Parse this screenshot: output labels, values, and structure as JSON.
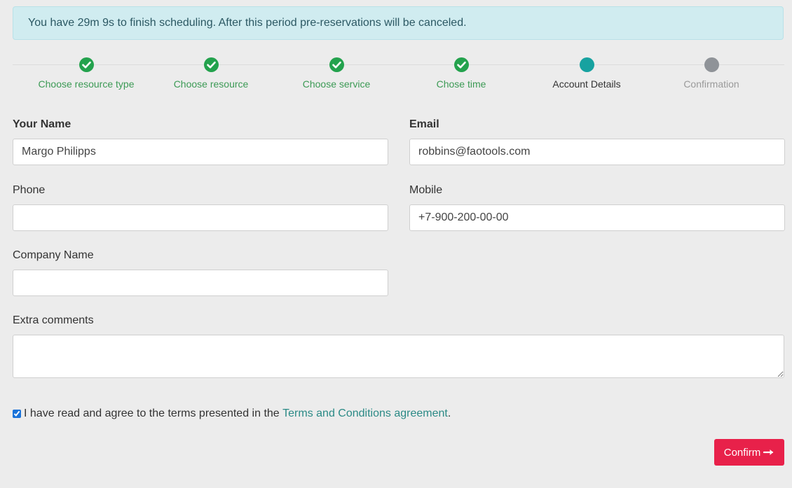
{
  "alert": {
    "message": "You have 29m 9s to finish scheduling. After this period pre-reservations will be canceled."
  },
  "steps": [
    {
      "label": "Choose resource type",
      "state": "done",
      "icon": "check-icon"
    },
    {
      "label": "Choose resource",
      "state": "done",
      "icon": "check-icon"
    },
    {
      "label": "Choose service",
      "state": "done",
      "icon": "check-icon"
    },
    {
      "label": "Chose time",
      "state": "done",
      "icon": "check-icon"
    },
    {
      "label": "Account Details",
      "state": "current",
      "icon": "dot-icon"
    },
    {
      "label": "Confirmation",
      "state": "pending",
      "icon": "dot-icon"
    }
  ],
  "form": {
    "name": {
      "label": "Your Name",
      "value": "Margo Philipps",
      "placeholder": ""
    },
    "email": {
      "label": "Email",
      "value": "robbins@faotools.com",
      "placeholder": ""
    },
    "phone": {
      "label": "Phone",
      "value": "",
      "placeholder": ""
    },
    "mobile": {
      "label": "Mobile",
      "value": "+7-900-200-00-00",
      "placeholder": ""
    },
    "company": {
      "label": "Company Name",
      "value": "",
      "placeholder": ""
    },
    "comments": {
      "label": "Extra comments",
      "value": "",
      "placeholder": ""
    }
  },
  "agreement": {
    "checked": true,
    "text": "I have read and agree to the terms presented in the",
    "link_text": "Terms and Conditions agreement",
    "suffix": "."
  },
  "actions": {
    "confirm_label": "Confirm"
  },
  "colors": {
    "done": "#23a24d",
    "current": "#17a2a0",
    "pending": "#8f9398",
    "confirm": "#e8214a",
    "link": "#2b8a86",
    "alert_bg": "#d0ecf0"
  }
}
